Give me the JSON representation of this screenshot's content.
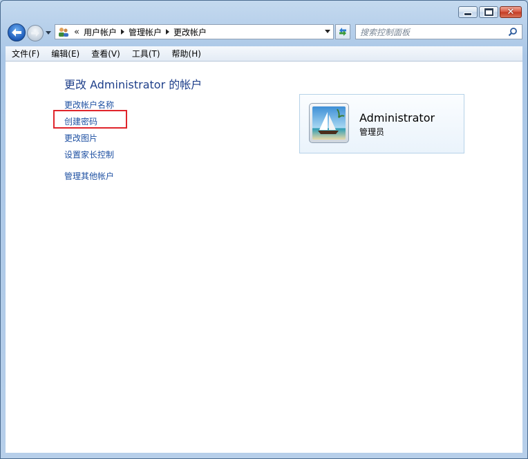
{
  "window": {
    "buttons": {
      "minimize": "minimize",
      "maximize": "maximize",
      "close": "✕"
    }
  },
  "navigation": {
    "breadcrumb_prefix": "«",
    "breadcrumbs": [
      "用户帐户",
      "管理帐户",
      "更改帐户"
    ]
  },
  "search": {
    "placeholder": "搜索控制面板"
  },
  "menu": [
    "文件(F)",
    "编辑(E)",
    "查看(V)",
    "工具(T)",
    "帮助(H)"
  ],
  "page": {
    "title": "更改 Administrator 的帐户",
    "links": [
      "更改帐户名称",
      "创建密码",
      "更改图片",
      "设置家长控制"
    ],
    "other_link": "管理其他帐户",
    "highlighted_link": "创建密码",
    "highlight_color": "#e0242b"
  },
  "account": {
    "name": "Administrator",
    "role": "管理员"
  },
  "colors": {
    "link": "#1e50a2",
    "title": "#1e3f8a",
    "close_button": "#c33a22"
  }
}
